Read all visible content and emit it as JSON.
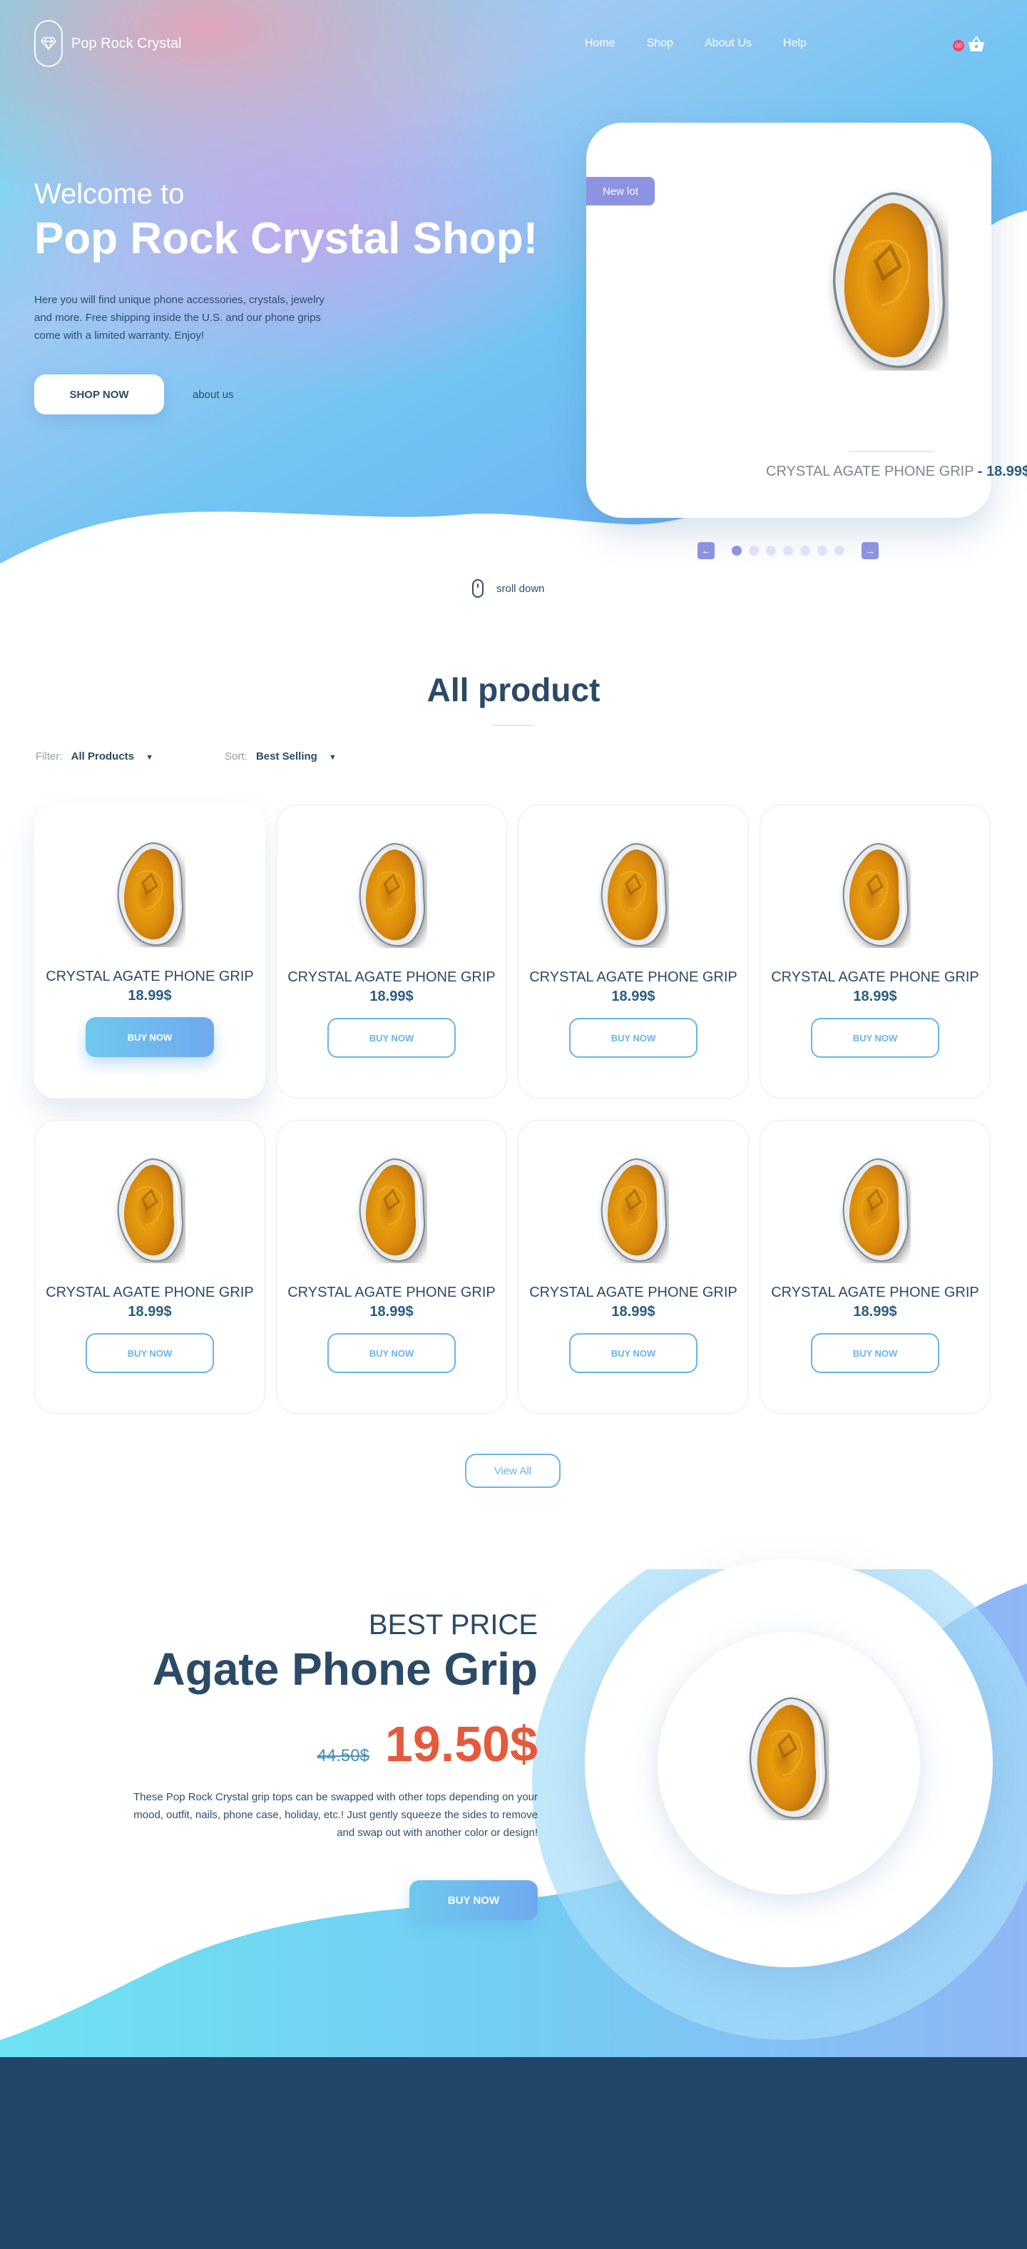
{
  "brand": {
    "name": "Pop Rock Crystal",
    "logo_icon": "diamond-icon"
  },
  "nav": {
    "links": [
      "Home",
      "Shop",
      "About Us",
      "Help"
    ],
    "cart_count": "00",
    "cart_icon": "basket-icon"
  },
  "hero": {
    "welcome": "Welcome to",
    "title": "Pop Rock Crystal Shop!",
    "description": "Here you will find unique phone accessories, crystals, jewelry and more. Free shipping inside the U.S. and our phone grips come with a limited warranty. Enjoy!",
    "shop_button": "SHOP NOW",
    "about_link": "about us",
    "badge": "New lot",
    "featured_name": "CRYSTAL AGATE PHONE GRIP",
    "featured_price": "- 18.99$",
    "slider": {
      "prev_icon": "arrow-left-icon",
      "next_icon": "arrow-right-icon",
      "slides": 7,
      "active_slide": 1
    },
    "scroll_label": "sroll down"
  },
  "products": {
    "title": "All product",
    "filter_label": "Filter:",
    "filter_value": "All Products",
    "sort_label": "Sort:",
    "sort_value": "Best Selling",
    "items": [
      {
        "name": "CRYSTAL AGATE PHONE GRIP",
        "price": "18.99$",
        "button": "BUY NOW"
      },
      {
        "name": "CRYSTAL AGATE PHONE GRIP",
        "price": "18.99$",
        "button": "BUY NOW"
      },
      {
        "name": "CRYSTAL AGATE PHONE GRIP",
        "price": "18.99$",
        "button": "BUY NOW"
      },
      {
        "name": "CRYSTAL AGATE PHONE GRIP",
        "price": "18.99$",
        "button": "BUY NOW"
      },
      {
        "name": "CRYSTAL AGATE PHONE GRIP",
        "price": "18.99$",
        "button": "BUY NOW"
      },
      {
        "name": "CRYSTAL AGATE PHONE GRIP",
        "price": "18.99$",
        "button": "BUY NOW"
      },
      {
        "name": "CRYSTAL AGATE PHONE GRIP",
        "price": "18.99$",
        "button": "BUY NOW"
      },
      {
        "name": "CRYSTAL AGATE PHONE GRIP",
        "price": "18.99$",
        "button": "BUY NOW"
      }
    ],
    "view_all": "View All"
  },
  "best_price": {
    "label": "BEST PRICE",
    "name": "Agate Phone Grip",
    "old_price": "44.50$",
    "new_price": "19.50$",
    "description": "These Pop Rock Crystal grip tops can be swapped with other tops depending on your mood, outfit, nails, phone case, holiday, etc.! Just gently squeeze the sides to remove and swap out with another color or design!",
    "button": "BUY NOW"
  },
  "colors": {
    "accent": "#69b5ea",
    "sale": "#e45a3c",
    "footer": "#214669",
    "badge": "#8d93e0"
  }
}
